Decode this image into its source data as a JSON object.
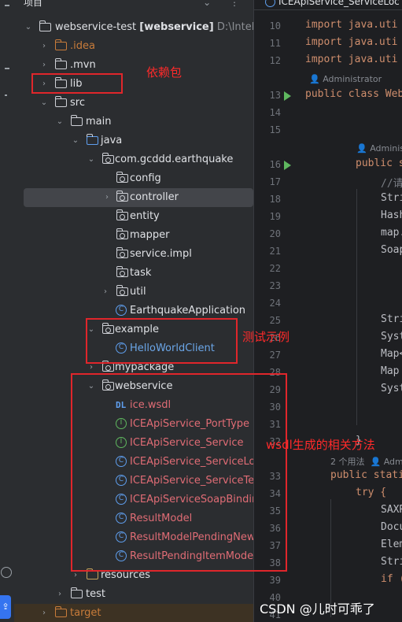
{
  "project_panel": {
    "header": "项目",
    "root": {
      "name": "webservice-test",
      "module": "[webservice]",
      "path": "D:\\Intelli"
    },
    "items": [
      {
        "label": ".idea",
        "type": "folder",
        "color": "orange"
      },
      {
        "label": ".mvn",
        "type": "folder"
      },
      {
        "label": "lib",
        "type": "folder"
      },
      {
        "label": "src",
        "type": "folder"
      },
      {
        "label": "main",
        "type": "folder"
      },
      {
        "label": "java",
        "type": "folder"
      },
      {
        "label": "com.gcddd.earthquake",
        "type": "package"
      },
      {
        "label": "config",
        "type": "package"
      },
      {
        "label": "controller",
        "type": "package"
      },
      {
        "label": "entity",
        "type": "package"
      },
      {
        "label": "mapper",
        "type": "package"
      },
      {
        "label": "service.impl",
        "type": "package"
      },
      {
        "label": "task",
        "type": "package"
      },
      {
        "label": "util",
        "type": "package"
      },
      {
        "label": "EarthquakeApplication",
        "type": "class"
      },
      {
        "label": "example",
        "type": "package"
      },
      {
        "label": "HelloWorldClient",
        "type": "class"
      },
      {
        "label": "mypackage",
        "type": "package"
      },
      {
        "label": "webservice",
        "type": "package"
      },
      {
        "label": "ice.wsdl",
        "type": "wsdl"
      },
      {
        "label": "ICEApiService_PortType",
        "type": "interface"
      },
      {
        "label": "ICEApiService_Service",
        "type": "interface"
      },
      {
        "label": "ICEApiService_ServiceLoc",
        "type": "class"
      },
      {
        "label": "ICEApiService_ServiceTes",
        "type": "class"
      },
      {
        "label": "ICEApiServiceSoapBindin",
        "type": "class"
      },
      {
        "label": "ResultModel",
        "type": "class"
      },
      {
        "label": "ResultModelPendingNew",
        "type": "class"
      },
      {
        "label": "ResultPendingItemModel",
        "type": "class"
      },
      {
        "label": "resources",
        "type": "folder"
      },
      {
        "label": "test",
        "type": "folder"
      },
      {
        "label": "target",
        "type": "folder",
        "color": "orange"
      }
    ]
  },
  "annotations": {
    "lib": "依赖包",
    "example": "测试示例",
    "webservice": "wsdl生成的相关方法"
  },
  "editor": {
    "tab_title": "ICEApiService_ServiceLoc",
    "line_numbers": [
      "10",
      "11",
      "12",
      "13",
      "14",
      "15",
      "16",
      "17",
      "18",
      "19",
      "20",
      "21",
      "22",
      "23",
      "24",
      "25",
      "26",
      "27",
      "28",
      "29",
      "30",
      "31",
      "32",
      "33",
      "34",
      "35",
      "36",
      "37",
      "38",
      "39",
      "40",
      "41"
    ],
    "lines": {
      "l10": "import java.uti",
      "l11": "import java.uti",
      "l12": "import java.uti",
      "l13": "public class Web",
      "l16": "public s",
      "l17": "//请",
      "l18": "Stri",
      "l19": "Hash",
      "l20": "map.",
      "l21": "Soap",
      "l25": "Stri",
      "l26": "Syst",
      "l27": "Map<",
      "l28": "Map ",
      "l29": "Syst",
      "l32": "}",
      "l33": "public stati",
      "l34": "try {",
      "l35": "SAXR",
      "l36": "Docu",
      "l37": "Elem",
      "l38": "Stri",
      "l39": "if ("
    },
    "hints": {
      "author1": "Administrator",
      "author2": "Administ",
      "usages": "2 个用法",
      "author3": "Adm"
    }
  },
  "watermark": "CSDN @儿时可乖了",
  "colors": {
    "annotation": "#e0262b",
    "accent": "#3574f0"
  }
}
